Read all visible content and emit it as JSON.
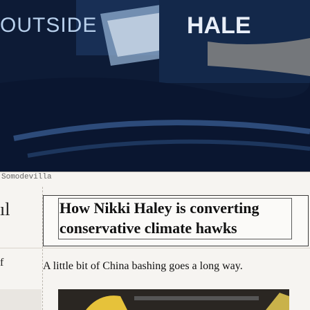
{
  "hero": {
    "left_text": "OUTSIDE",
    "right_text": "HALE"
  },
  "caption": "Somodevilla",
  "left_fragments": [
    "ıl",
    "f"
  ],
  "article": {
    "headline": "How Nikki Haley is converting conservative climate hawks",
    "subline": "A little bit of China bashing goes a long way."
  },
  "colors": {
    "hero_bg": "#0c1a33",
    "page_bg": "#f6f4f1"
  }
}
